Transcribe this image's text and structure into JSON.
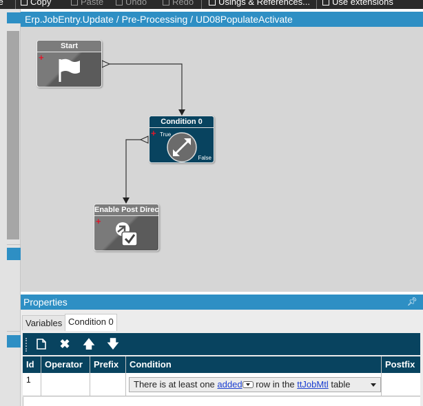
{
  "toolbar": {
    "copy": "Copy",
    "paste": "Paste",
    "undo": "Undo",
    "redo": "Redo",
    "usings": "Usings & References...",
    "extensions": "Use extensions"
  },
  "designer": {
    "breadcrumb": "Erp.JobEntry.Update / Pre-Processing / UD08PopulateActivate"
  },
  "nodes": {
    "start": {
      "title": "Start"
    },
    "condition": {
      "title": "Condition 0",
      "true_label": "True",
      "false_label": "False"
    },
    "action": {
      "title": "Enable Post Directi"
    }
  },
  "properties": {
    "title": "Properties",
    "tabs": [
      {
        "label": "Variables",
        "active": false
      },
      {
        "label": "Condition 0",
        "active": true
      }
    ],
    "grid_toolbar_icons": [
      "new-document-icon",
      "delete-icon",
      "move-up-icon",
      "move-down-icon"
    ],
    "columns": [
      "Id",
      "Operator",
      "Prefix",
      "Condition",
      "Postfix"
    ],
    "rows": [
      {
        "id": "1",
        "operator": "",
        "prefix": "",
        "condition": {
          "text1": "There is at least one",
          "link1": "added",
          "text2": "row in the",
          "link2": "ttJobMtl",
          "text3": "table"
        },
        "postfix": ""
      }
    ]
  },
  "colors": {
    "accent_blue": "#2e8fc4",
    "dark_navy": "#08435f",
    "canvas_grey": "#d6d6d6",
    "node_grey": "#7a7a7a",
    "plus_red": "#e0182b",
    "link_blue": "#1a3ed1"
  }
}
